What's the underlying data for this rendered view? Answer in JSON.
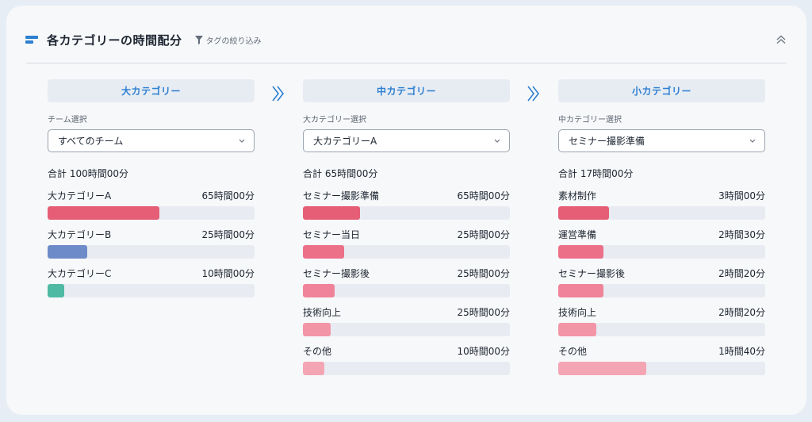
{
  "header": {
    "title": "各カテゴリーの時間配分",
    "tag_filter": "タグの絞り込み",
    "icons": {
      "title": "bar-chart-icon",
      "filter": "filter-icon",
      "collapse": "chevron-double-up-icon"
    },
    "accent": "#2d7fd0"
  },
  "columns": [
    {
      "heading": "大カテゴリー",
      "select_label": "チーム選択",
      "select_value": "すべてのチーム",
      "total": "合計 100時間00分",
      "items": [
        {
          "label": "大カテゴリーA",
          "time": "65時間00分",
          "share": 0.54,
          "color": "#e55e76"
        },
        {
          "label": "大カテゴリーB",
          "time": "25時間00分",
          "share": 0.19,
          "color": "#6e8bc9"
        },
        {
          "label": "大カテゴリーC",
          "time": "10時間00分",
          "share": 0.08,
          "color": "#4fb9a3"
        }
      ]
    },
    {
      "heading": "中カテゴリー",
      "select_label": "大カテゴリー選択",
      "select_value": "大カテゴリーA",
      "total": "合計 65時間00分",
      "items": [
        {
          "label": "セミナー撮影準備",
          "time": "65時間00分",
          "share": 0.275,
          "color": "#e55e76"
        },
        {
          "label": "セミナー当日",
          "time": "25時間00分",
          "share": 0.2,
          "color": "#ec7088"
        },
        {
          "label": "セミナー撮影後",
          "time": "25時間00分",
          "share": 0.155,
          "color": "#f08399"
        },
        {
          "label": "技術向上",
          "time": "25時間00分",
          "share": 0.135,
          "color": "#f295a7"
        },
        {
          "label": "その他",
          "time": "10時間00分",
          "share": 0.105,
          "color": "#f4a5b4"
        }
      ]
    },
    {
      "heading": "小カテゴリー",
      "select_label": "中カテゴリー選択",
      "select_value": "セミナー撮影準備",
      "total": "合計 17時間00分",
      "items": [
        {
          "label": "素材制作",
          "time": "3時間00分",
          "share": 0.245,
          "color": "#e55e76"
        },
        {
          "label": "運営準備",
          "time": "2時間30分",
          "share": 0.22,
          "color": "#ec7088"
        },
        {
          "label": "セミナー撮影後",
          "time": "2時間20分",
          "share": 0.22,
          "color": "#f08399"
        },
        {
          "label": "技術向上",
          "time": "2時間20分",
          "share": 0.185,
          "color": "#f295a7"
        },
        {
          "label": "その他",
          "time": "1時間40分",
          "share": 0.425,
          "color": "#f4a5b4"
        }
      ]
    }
  ]
}
